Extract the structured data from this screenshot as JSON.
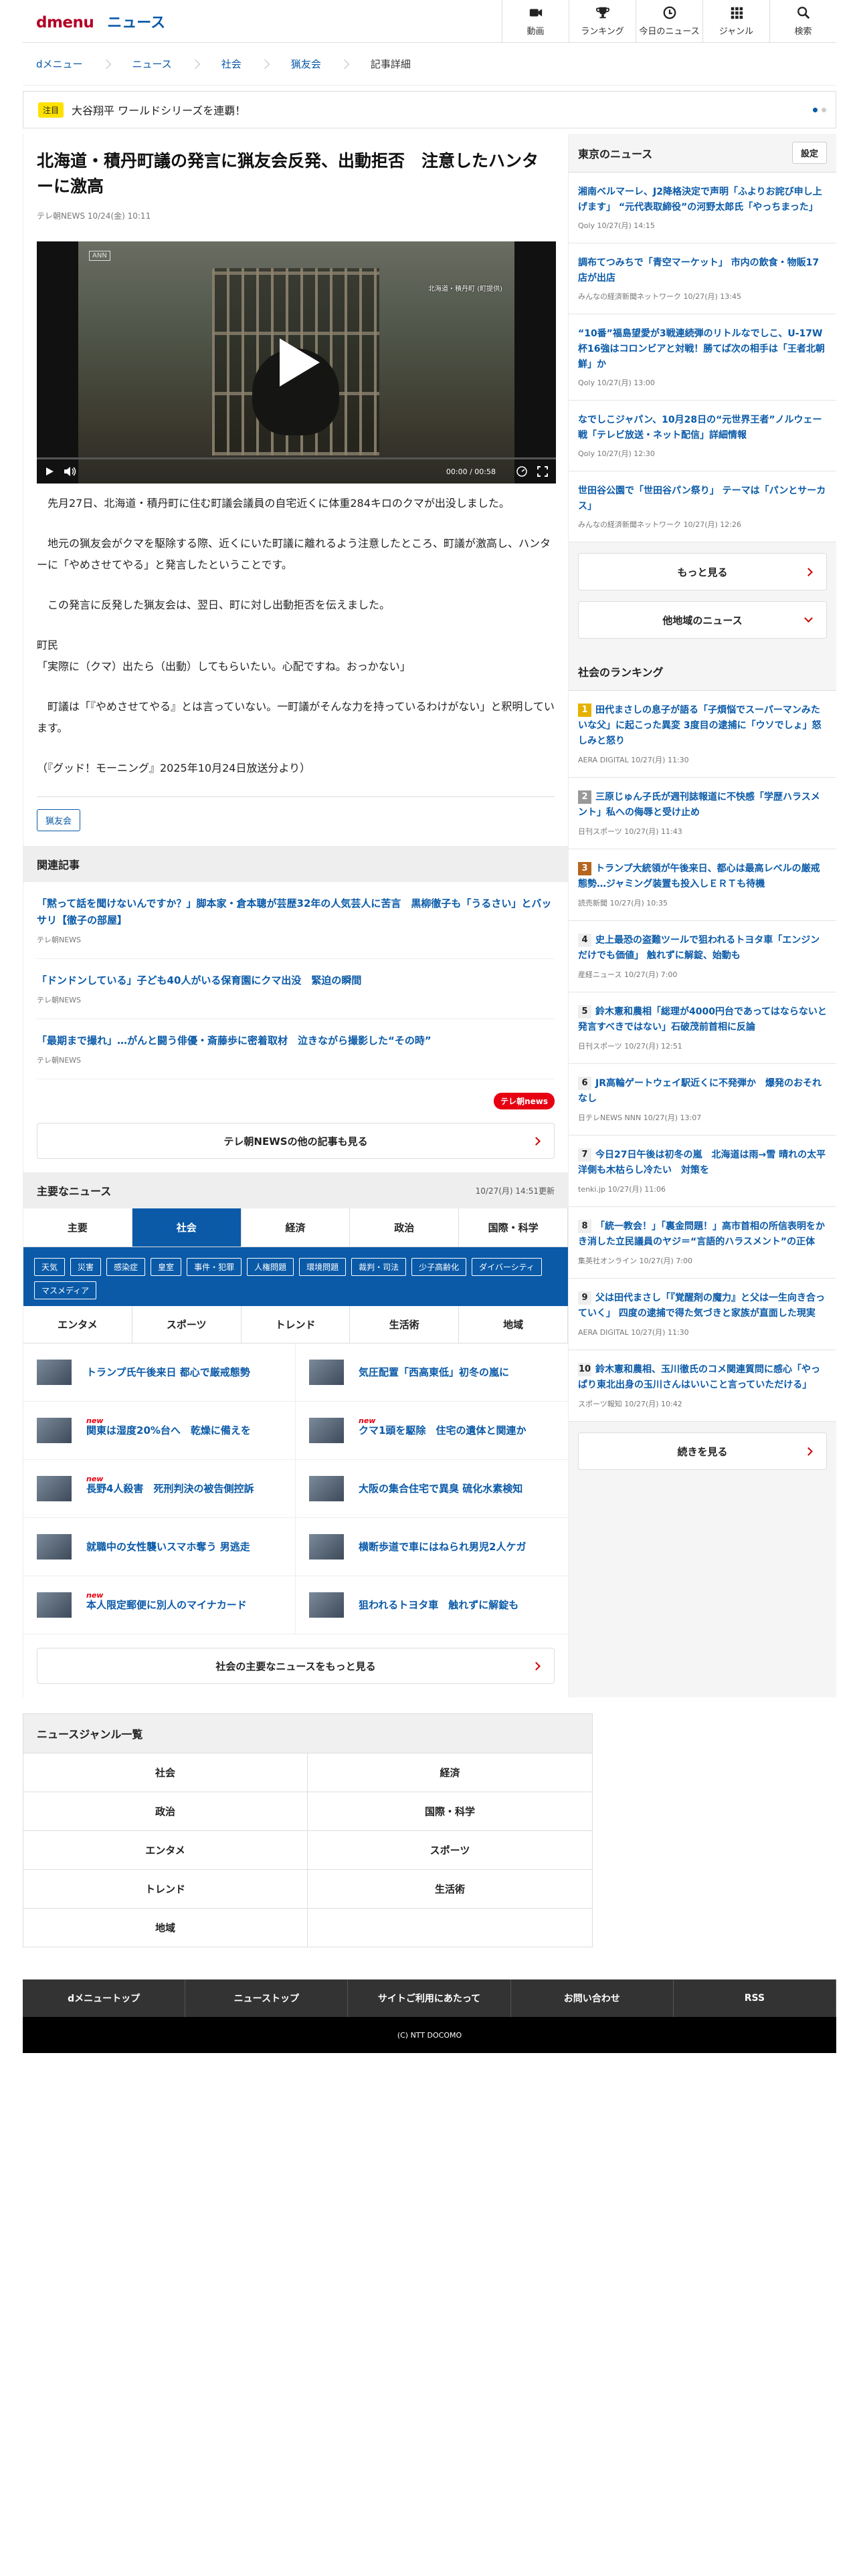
{
  "header": {
    "logo_dmenu": "dmenu",
    "logo_news": "ニュース",
    "nav": [
      {
        "label": "動画",
        "icon": "video-camera-icon"
      },
      {
        "label": "ランキング",
        "icon": "trophy-icon"
      },
      {
        "label": "今日のニュース",
        "icon": "clock-icon"
      },
      {
        "label": "ジャンル",
        "icon": "grid-icon"
      },
      {
        "label": "検索",
        "icon": "search-icon"
      }
    ]
  },
  "breadcrumb": [
    "dメニュー",
    "ニュース",
    "社会",
    "猟友会",
    "記事詳細"
  ],
  "notice": {
    "tag": "注目",
    "text": "大谷翔平 ワールドシリーズを連覇！"
  },
  "article": {
    "title": "北海道・積丹町議の発言に猟友会反発、出動拒否　注意したハンターに激高",
    "meta": "テレ朝NEWS 10/24(金) 10:11",
    "video": {
      "time": "00:00 / 00:58",
      "logo": "ANN",
      "caption": "北海道・積丹町 (町提供)"
    },
    "paragraphs": [
      "　先月27日、北海道・積丹町に住む町議会議員の自宅近くに体重284キロのクマが出没しました。",
      "　地元の猟友会がクマを駆除する際、近くにいた町議に離れるよう注意したところ、町議が激高し、ハンターに「やめさせてやる」と発言したということです。",
      "　この発言に反発した猟友会は、翌日、町に対し出動拒否を伝えました。",
      "町民\n「実際に（クマ）出たら（出動）してもらいたい。心配ですね。おっかない」",
      "　町議は「『やめさせてやる』とは言っていない。一町議がそんな力を持っているわけがない」と釈明しています。",
      "（『グッド！モーニング』2025年10月24日放送分より）"
    ],
    "tag": "猟友会"
  },
  "related": {
    "title": "関連記事",
    "items": [
      {
        "title": "「黙って話を聞けないんですか？」脚本家・倉本聰が芸歴32年の人気芸人に苦言　黒柳徹子も「うるさい」とバッサリ【徹子の部屋】",
        "source": "テレ朝NEWS"
      },
      {
        "title": "「ドンドンしている」子ども40人がいる保育園にクマ出没　緊迫の瞬間",
        "source": "テレ朝NEWS"
      },
      {
        "title": "「最期まで撮れ」…がんと闘う俳優・斎藤歩に密着取材　泣きながら撮影した“その時”",
        "source": "テレ朝NEWS"
      }
    ],
    "brand": "テレ朝news",
    "more": "テレ朝NEWSの他の記事も見る"
  },
  "major": {
    "title": "主要なニュース",
    "updated": "10/27(月) 14:51更新",
    "tabs": [
      "主要",
      "社会",
      "経済",
      "政治",
      "国際・科学"
    ],
    "chips": [
      "天気",
      "災害",
      "感染症",
      "皇室",
      "事件・犯罪",
      "人権問題",
      "環境問題",
      "裁判・司法",
      "少子高齢化",
      "ダイバーシティ",
      "マスメディア"
    ],
    "subtabs": [
      "エンタメ",
      "スポーツ",
      "トレンド",
      "生活術",
      "地域"
    ],
    "items": [
      {
        "title": "トランプ氏午後来日 都心で厳戒態勢",
        "new": ""
      },
      {
        "title": "気圧配置「西高東低」初冬の嵐に",
        "new": ""
      },
      {
        "title": "関東は湿度20%台へ　乾燥に備えを",
        "new": "new"
      },
      {
        "title": "クマ1頭を駆除　住宅の遺体と関連か",
        "new": "new"
      },
      {
        "title": "長野4人殺害　死刑判決の被告側控訴",
        "new": "new"
      },
      {
        "title": "大阪の集合住宅で異臭 硫化水素検知",
        "new": ""
      },
      {
        "title": "就職中の女性襲いスマホ奪う 男逃走",
        "new": ""
      },
      {
        "title": "横断歩道で車にはねられ男児2人ケガ",
        "new": ""
      },
      {
        "title": "本人限定郵便に別人のマイナカード",
        "new": "new"
      },
      {
        "title": "狙われるトヨタ車　触れずに解錠も",
        "new": ""
      }
    ],
    "more": "社会の主要なニュースをもっと見る"
  },
  "sidebar": {
    "local_title": "東京のニュース",
    "settings": "設定",
    "local": [
      {
        "title": "湘南ベルマーレ、J2降格決定で声明「ふよりお詫び申し上げます」 “元代表取締役”の河野太郎氏「やっちまった」",
        "source": "Qoly 10/27(月) 14:15"
      },
      {
        "title": "調布てつみちで「青空マーケット」 市内の飲食・物販17店が出店",
        "source": "みんなの経済新聞ネットワーク 10/27(月) 13:45"
      },
      {
        "title": "“10番”福島望愛が3戦連続弾のリトルなでしこ、U-17W杯16強はコロンビアと対戦！勝てば次の相手は「王者北朝鮮」か",
        "source": "Qoly 10/27(月) 13:00"
      },
      {
        "title": "なでしこジャパン、10月28日の“元世界王者”ノルウェー戦「テレビ放送・ネット配信」詳細情報",
        "source": "Qoly 10/27(月) 12:30"
      },
      {
        "title": "世田谷公園で「世田谷パン祭り」 テーマは「パンとサーカス」",
        "source": "みんなの経済新聞ネットワーク 10/27(月) 12:26"
      }
    ],
    "local_more": "もっと見る",
    "other_region": "他地域のニュース",
    "rank_title": "社会のランキング",
    "ranking": [
      {
        "n": "1",
        "title": "田代まさしの息子が語る「子煩悩でスーパーマンみたいな父」に起こった異変 3度目の逮捕に「ウソでしょ」怒しみと怒り",
        "source": "AERA DIGITAL 10/27(月) 11:30"
      },
      {
        "n": "2",
        "title": "三原じゅん子氏が週刊誌報道に不快感「学歴ハラスメント」私への侮辱と受け止め",
        "source": "日刊スポーツ 10/27(月) 11:43"
      },
      {
        "n": "3",
        "title": "トランプ大統領が午後来日、都心は最高レベルの厳戒態勢…ジャミング装置も投入しＥＲＴも待機",
        "source": "読売新聞 10/27(月) 10:35"
      },
      {
        "n": "4",
        "title": "史上最恐の盗難ツールで狙われるトヨタ車「エンジンだけでも価値」 触れずに解錠、始動も",
        "source": "産経ニュース 10/27(月) 7:00"
      },
      {
        "n": "5",
        "title": "鈴木憲和農相「総理が4000円台であってはならないと発言すべきではない」石破茂前首相に反論",
        "source": "日刊スポーツ 10/27(月) 12:51"
      },
      {
        "n": "6",
        "title": "JR高輪ゲートウェイ駅近くに不発弾か　爆発のおそれなし",
        "source": "日テレNEWS NNN 10/27(月) 13:07"
      },
      {
        "n": "7",
        "title": "今日27日午後は初冬の嵐　北海道は雨→雪 晴れの太平洋側も木枯らし冷たい　対策を",
        "source": "tenki.jp 10/27(月) 11:06"
      },
      {
        "n": "8",
        "title": "「統一教会！」「裏金問題！」高市首相の所信表明をかき消した立民議員のヤジ＝“言語的ハラスメント”の正体",
        "source": "集英社オンライン 10/27(月) 7:00"
      },
      {
        "n": "9",
        "title": "父は田代まさし「『覚醒剤の魔力』と父は一生向き合っていく」 四度の逮捕で得た気づきと家族が直面した現実",
        "source": "AERA DIGITAL 10/27(月) 11:30"
      },
      {
        "n": "10",
        "title": "鈴木憲和農相、玉川徹氏のコメ関連質問に感心「やっぱり東北出身の玉川さんはいいこと言っていただける」",
        "source": "スポーツ報知 10/27(月) 10:42"
      }
    ],
    "rank_more": "続きを見る"
  },
  "genres": {
    "title": "ニュースジャンル一覧",
    "items": [
      "社会",
      "経済",
      "政治",
      "国際・科学",
      "エンタメ",
      "スポーツ",
      "トレンド",
      "生活術",
      "地域",
      ""
    ]
  },
  "footer": {
    "links": [
      "dメニュートップ",
      "ニューストップ",
      "サイトご利用にあたって",
      "お問い合わせ",
      "RSS"
    ],
    "copyright": "(C) NTT DOCOMO"
  }
}
